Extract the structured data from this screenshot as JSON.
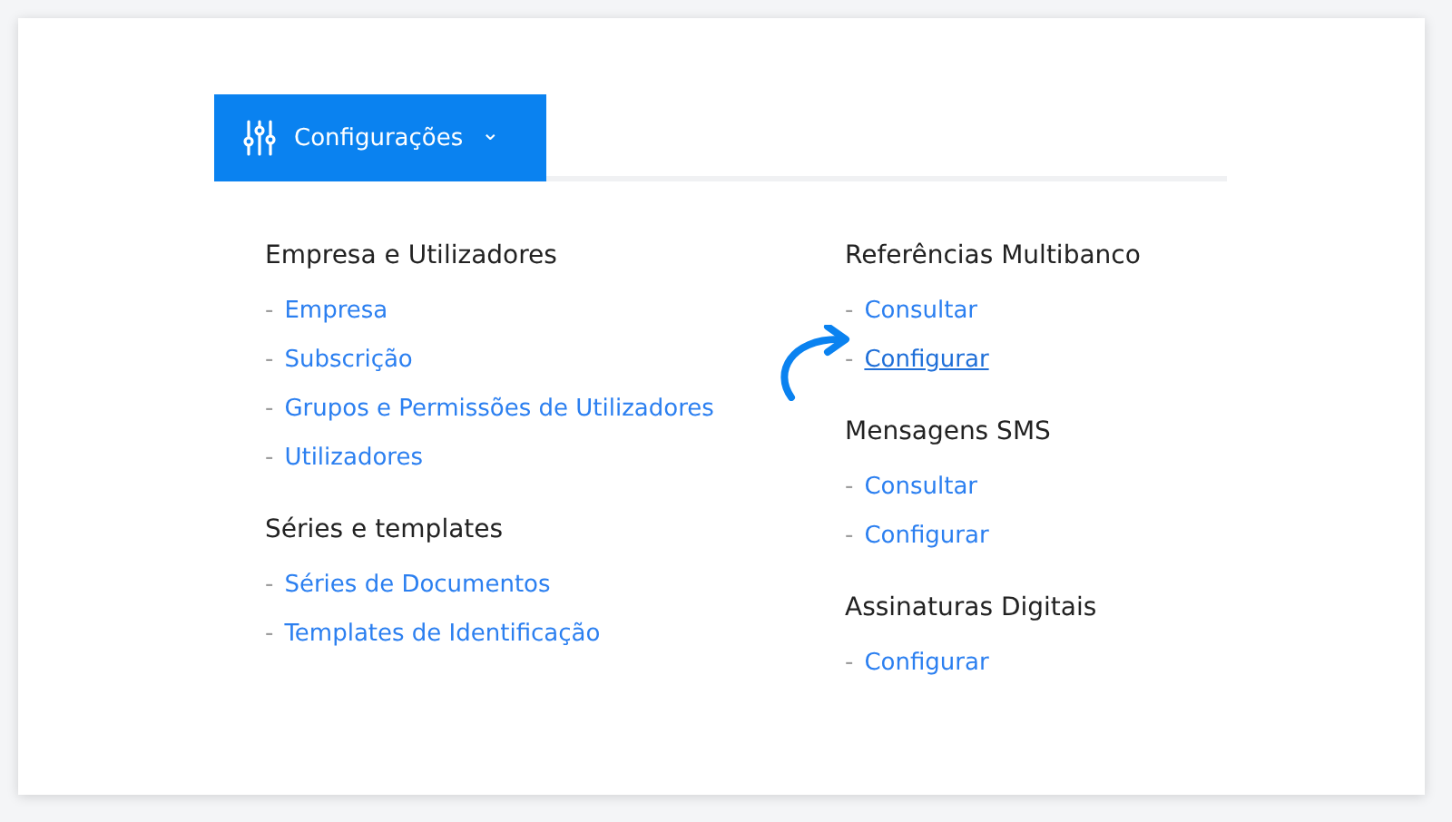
{
  "menu_button": {
    "label": "Configurações",
    "caret": "⌄"
  },
  "columns": [
    {
      "groups": [
        {
          "title": "Empresa e Utilizadores",
          "links": [
            {
              "bullet": "-",
              "label": "Empresa",
              "highlighted": false
            },
            {
              "bullet": "-",
              "label": "Subscrição",
              "highlighted": false
            },
            {
              "bullet": "-",
              "label": "Grupos e Permissões de Utilizadores",
              "highlighted": false
            },
            {
              "bullet": "-",
              "label": "Utilizadores",
              "highlighted": false
            }
          ]
        },
        {
          "title": "Séries e templates",
          "links": [
            {
              "bullet": "-",
              "label": "Séries de Documentos",
              "highlighted": false
            },
            {
              "bullet": "-",
              "label": "Templates de Identificação",
              "highlighted": false
            }
          ]
        }
      ]
    },
    {
      "groups": [
        {
          "title": "Referências Multibanco",
          "links": [
            {
              "bullet": "-",
              "label": "Consultar",
              "highlighted": false
            },
            {
              "bullet": "-",
              "label": "Configurar",
              "highlighted": true
            }
          ]
        },
        {
          "title": "Mensagens SMS",
          "links": [
            {
              "bullet": "-",
              "label": "Consultar",
              "highlighted": false
            },
            {
              "bullet": "-",
              "label": "Configurar",
              "highlighted": false
            }
          ]
        },
        {
          "title": "Assinaturas Digitais",
          "links": [
            {
              "bullet": "-",
              "label": "Configurar",
              "highlighted": false
            }
          ]
        }
      ]
    }
  ]
}
